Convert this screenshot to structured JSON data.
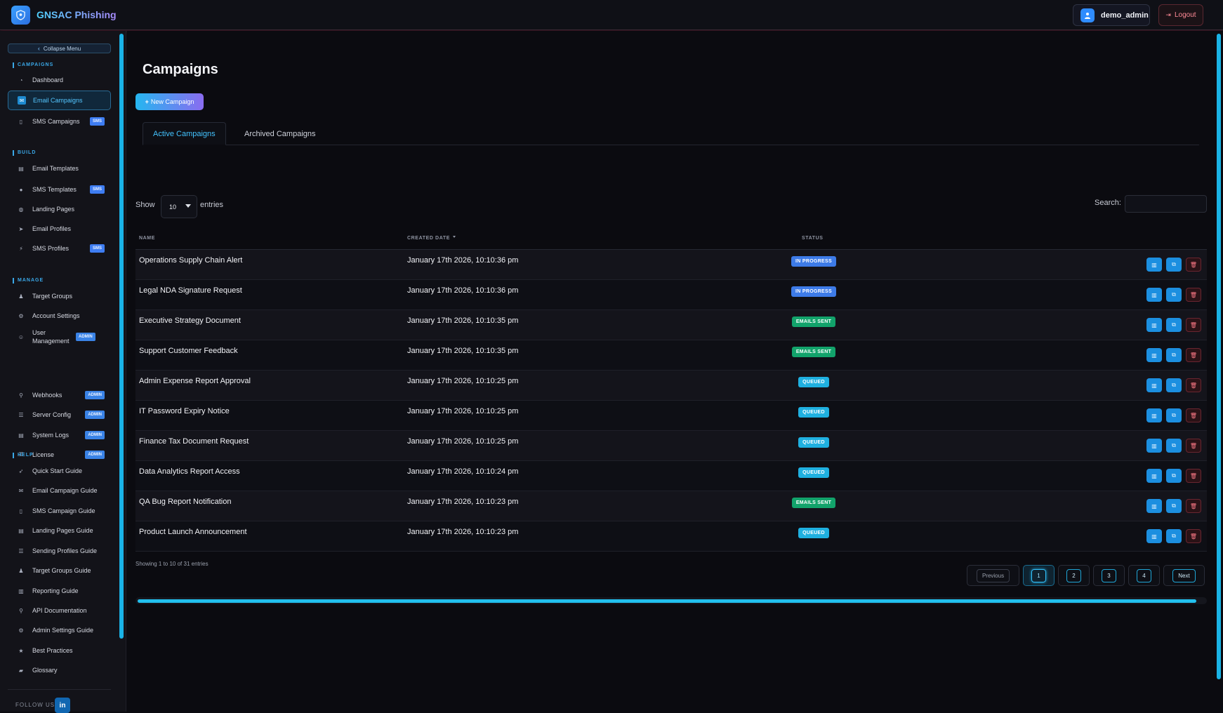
{
  "app": {
    "title": "GNSAC Phishing"
  },
  "user": {
    "name": "demo_admin",
    "logout_label": "Logout"
  },
  "sidebar": {
    "collapse_label": "Collapse Menu",
    "sections": [
      {
        "label": "CAMPAIGNS"
      },
      {
        "label": "BUILD"
      },
      {
        "label": "MANAGE"
      },
      {
        "label": "HELP"
      }
    ],
    "items": [
      {
        "label": "Dashboard",
        "icon": "dashboard-icon"
      },
      {
        "label": "Email Campaigns",
        "icon": "envelope-icon",
        "active": true
      },
      {
        "label": "SMS Campaigns",
        "icon": "mobile-icon",
        "badge": "SMS"
      },
      {
        "label": "Email Templates",
        "icon": "file-icon"
      },
      {
        "label": "SMS Templates",
        "icon": "comment-icon",
        "badge": "SMS"
      },
      {
        "label": "Landing Pages",
        "icon": "globe-icon"
      },
      {
        "label": "Email Profiles",
        "icon": "paper-plane-icon"
      },
      {
        "label": "SMS Profiles",
        "icon": "broadcast-icon",
        "badge": "SMS"
      },
      {
        "label": "Target Groups",
        "icon": "users-icon"
      },
      {
        "label": "Account Settings",
        "icon": "gear-icon"
      },
      {
        "label": "User Management",
        "icon": "user-cog-icon",
        "badge": "ADMIN"
      },
      {
        "label": "Webhooks",
        "icon": "plug-icon",
        "badge": "ADMIN"
      },
      {
        "label": "Server Config",
        "icon": "server-icon",
        "badge": "ADMIN"
      },
      {
        "label": "System Logs",
        "icon": "log-icon",
        "badge": "ADMIN"
      },
      {
        "label": "License",
        "icon": "key-icon",
        "badge": "ADMIN"
      },
      {
        "label": "Quick Start Guide",
        "icon": "rocket-icon"
      },
      {
        "label": "Email Campaign Guide",
        "icon": "envelope-icon"
      },
      {
        "label": "SMS Campaign Guide",
        "icon": "mobile-icon"
      },
      {
        "label": "Landing Pages Guide",
        "icon": "file-icon"
      },
      {
        "label": "Sending Profiles Guide",
        "icon": "server-icon"
      },
      {
        "label": "Target Groups Guide",
        "icon": "users-icon"
      },
      {
        "label": "Reporting Guide",
        "icon": "chart-icon"
      },
      {
        "label": "API Documentation",
        "icon": "plug-icon"
      },
      {
        "label": "Admin Settings Guide",
        "icon": "gear-icon"
      },
      {
        "label": "Best Practices",
        "icon": "star-icon"
      },
      {
        "label": "Glossary",
        "icon": "book-icon"
      }
    ],
    "follow_label": "FOLLOW US",
    "linkedin": "in"
  },
  "main": {
    "title": "Campaigns",
    "new_button": "New Campaign",
    "tabs": [
      {
        "label": "Active Campaigns",
        "active": true
      },
      {
        "label": "Archived Campaigns"
      }
    ],
    "show_label": "Show",
    "entries_value": "10",
    "entries_label": "entries",
    "search_label": "Search:",
    "columns": [
      "NAME",
      "CREATED DATE",
      "STATUS"
    ],
    "rows": [
      {
        "name": "Operations Supply Chain Alert",
        "date": "January 17th 2026, 10:10:36 pm",
        "status": "IN PROGRESS"
      },
      {
        "name": "Legal NDA Signature Request",
        "date": "January 17th 2026, 10:10:36 pm",
        "status": "IN PROGRESS"
      },
      {
        "name": "Executive Strategy Document",
        "date": "January 17th 2026, 10:10:35 pm",
        "status": "EMAILS SENT"
      },
      {
        "name": "Support Customer Feedback",
        "date": "January 17th 2026, 10:10:35 pm",
        "status": "EMAILS SENT"
      },
      {
        "name": "Admin Expense Report Approval",
        "date": "January 17th 2026, 10:10:25 pm",
        "status": "QUEUED"
      },
      {
        "name": "IT Password Expiry Notice",
        "date": "January 17th 2026, 10:10:25 pm",
        "status": "QUEUED"
      },
      {
        "name": "Finance Tax Document Request",
        "date": "January 17th 2026, 10:10:25 pm",
        "status": "QUEUED"
      },
      {
        "name": "Data Analytics Report Access",
        "date": "January 17th 2026, 10:10:24 pm",
        "status": "QUEUED"
      },
      {
        "name": "QA Bug Report Notification",
        "date": "January 17th 2026, 10:10:23 pm",
        "status": "EMAILS SENT"
      },
      {
        "name": "Product Launch Announcement",
        "date": "January 17th 2026, 10:10:23 pm",
        "status": "QUEUED"
      }
    ],
    "status_colors": {
      "IN PROGRESS": "#3d7be8",
      "EMAILS SENT": "#12a36b",
      "QUEUED": "#1fb0e0"
    },
    "info": "Showing 1 to 10 of 31 entries",
    "pagination": {
      "previous": "Previous",
      "pages": [
        "1",
        "2",
        "3",
        "4"
      ],
      "current": "1",
      "next": "Next"
    }
  }
}
